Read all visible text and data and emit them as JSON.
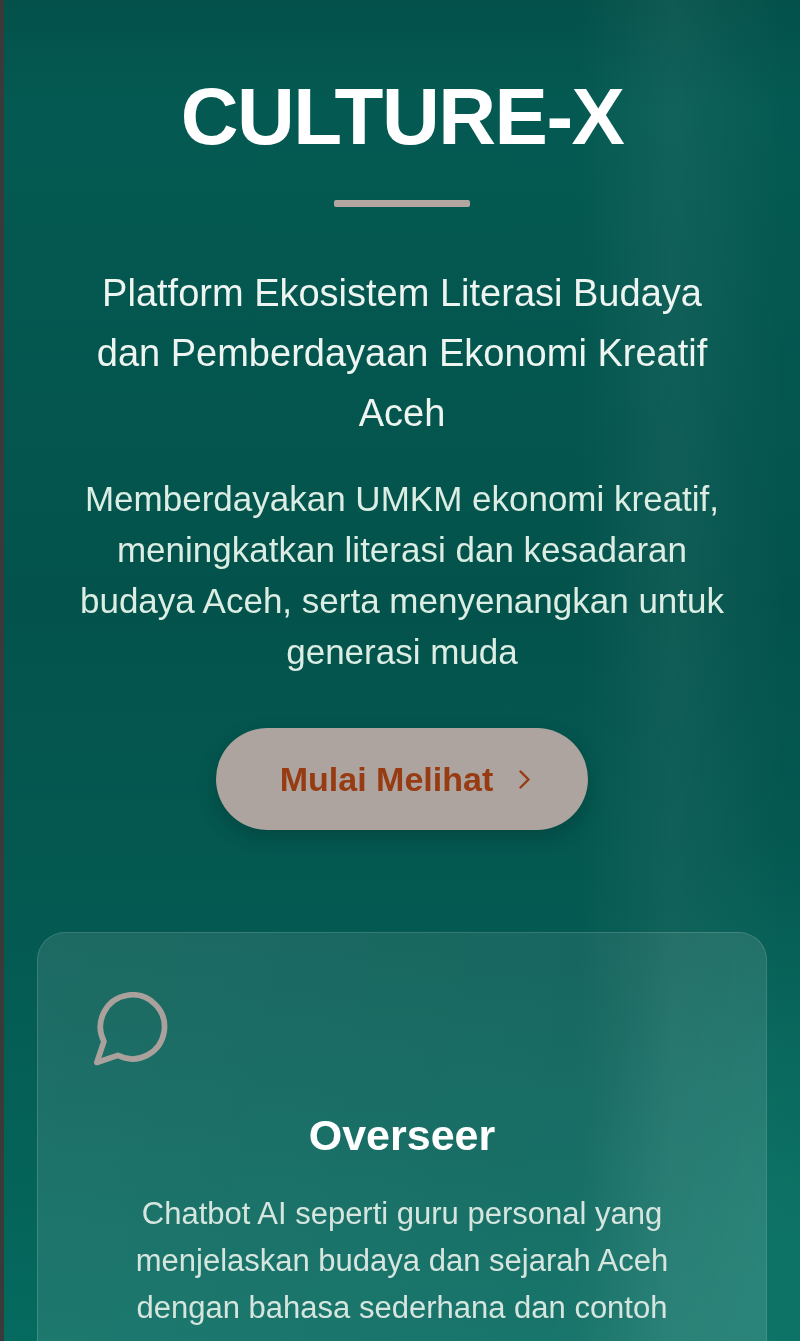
{
  "hero": {
    "title": "CULTURE-X",
    "subtitle": "Platform Ekosistem Literasi Budaya dan Pemberdayaan Ekonomi Kreatif Aceh",
    "description": "Memberdayakan UMKM ekonomi kreatif, meningkatkan literasi dan kesadaran budaya Aceh, serta menyenangkan untuk generasi muda",
    "button": {
      "label": "Mulai Melihat"
    }
  },
  "features": [
    {
      "title": "Overseer",
      "description": "Chatbot AI seperti guru personal yang menjelaskan budaya dan sejarah Aceh dengan bahasa sederhana dan contoh"
    }
  ]
}
